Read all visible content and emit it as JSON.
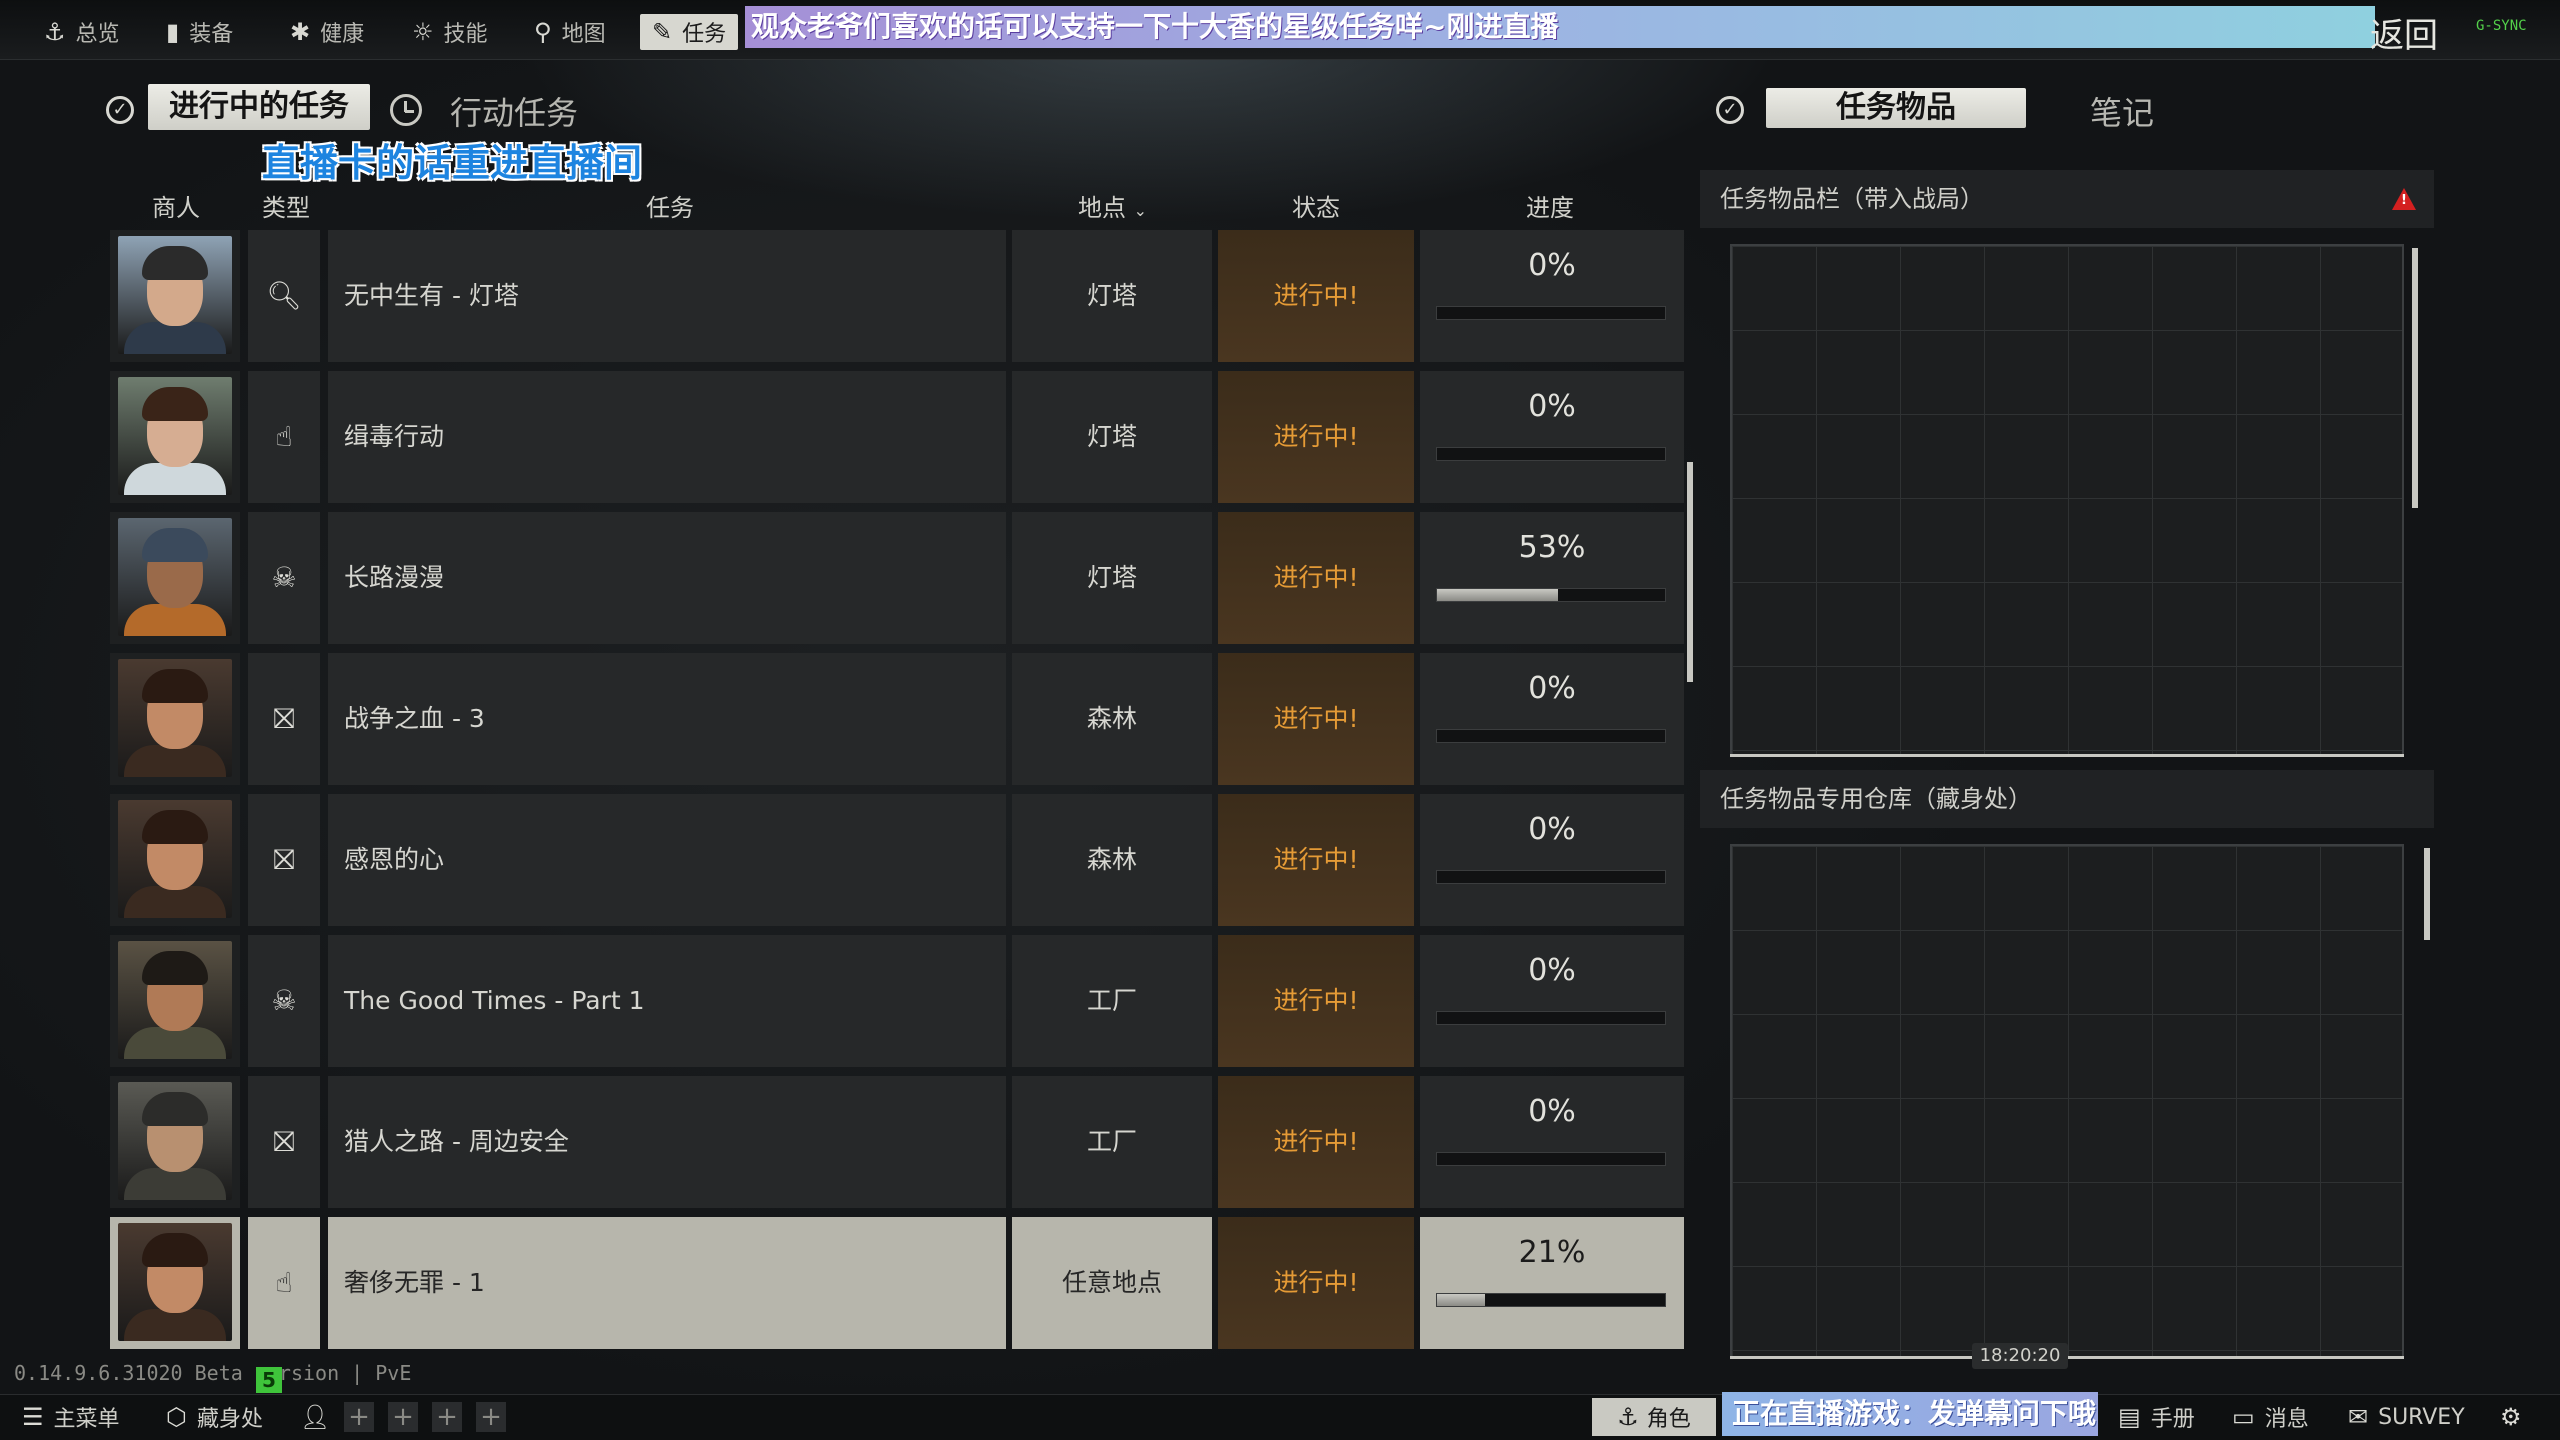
{
  "top_nav": [
    {
      "label": "总览",
      "icon": "anchor-icon"
    },
    {
      "label": "装备",
      "icon": "vest-icon"
    },
    {
      "label": "健康",
      "icon": "health-icon"
    },
    {
      "label": "技能",
      "icon": "skills-icon"
    },
    {
      "label": "地图",
      "icon": "map-pin-icon"
    },
    {
      "label": "任务",
      "icon": "tasks-icon",
      "active": true
    }
  ],
  "stream_banner_top": "观众老爷们喜欢的话可以支持一下十大香的星级任务咩~刚进直播",
  "back_label": "返回",
  "gsync_label": "G-SYNC",
  "tabs": {
    "active_quests": "进行中的任务",
    "action_quests": "行动任务",
    "quest_items": "任务物品",
    "notes": "笔记"
  },
  "overlay_text": "直播卡的话重进直播间",
  "table_headers": {
    "trader": "商人",
    "type": "类型",
    "quest": "任务",
    "location": "地点",
    "status": "状态",
    "progress": "进度"
  },
  "quests": [
    {
      "trader": "skier",
      "type_icon": "search-icon",
      "name": "无中生有 - 灯塔",
      "location": "灯塔",
      "status": "进行中!",
      "progress": "0%",
      "fraction": 0.0
    },
    {
      "trader": "therapist",
      "type_icon": "hand-icon",
      "name": "缉毒行动",
      "location": "灯塔",
      "status": "进行中!",
      "progress": "0%",
      "fraction": 0.0
    },
    {
      "trader": "peacekeeper",
      "type_icon": "skull-icon",
      "name": "长路漫漫",
      "location": "灯塔",
      "status": "进行中!",
      "progress": "53%",
      "fraction": 0.53
    },
    {
      "trader": "ragman",
      "type_icon": "exit-icon",
      "name": "战争之血 - 3",
      "location": "森林",
      "status": "进行中!",
      "progress": "0%",
      "fraction": 0.0
    },
    {
      "trader": "ragman",
      "type_icon": "exit-icon",
      "name": "感恩的心",
      "location": "森林",
      "status": "进行中!",
      "progress": "0%",
      "fraction": 0.0
    },
    {
      "trader": "prapor",
      "type_icon": "skull-icon",
      "name": "The Good Times - Part 1",
      "location": "工厂",
      "status": "进行中!",
      "progress": "0%",
      "fraction": 0.0
    },
    {
      "trader": "jaeger",
      "type_icon": "exit-icon",
      "name": "猎人之路 - 周边安全",
      "location": "工厂",
      "status": "进行中!",
      "progress": "0%",
      "fraction": 0.0
    },
    {
      "trader": "ragman",
      "type_icon": "hand-icon",
      "name": "奢侈无罪 - 1",
      "location": "任意地点",
      "status": "进行中!",
      "progress": "21%",
      "fraction": 0.21,
      "selected": true
    }
  ],
  "right_panel": {
    "inventory_title": "任务物品栏（带入战局）",
    "stash_title": "任务物品专用仓库（藏身处）",
    "time": "18:20:20"
  },
  "version": "0.14.9.6.31020 Beta version | PvE",
  "version_badge": "5",
  "bottom_bar": {
    "main_menu": "主菜单",
    "hideout": "藏身处",
    "character": "角色",
    "stream_banner": "正在直播游戏：发弹幕问下哦",
    "handbook": "手册",
    "messages": "消息",
    "survey": "SURVEY"
  },
  "colors": {
    "status_orange": "#e59b36",
    "warning_red": "#d42020",
    "banner_purple": "#a58fd6",
    "overlay_blue": "#1d84e0"
  }
}
